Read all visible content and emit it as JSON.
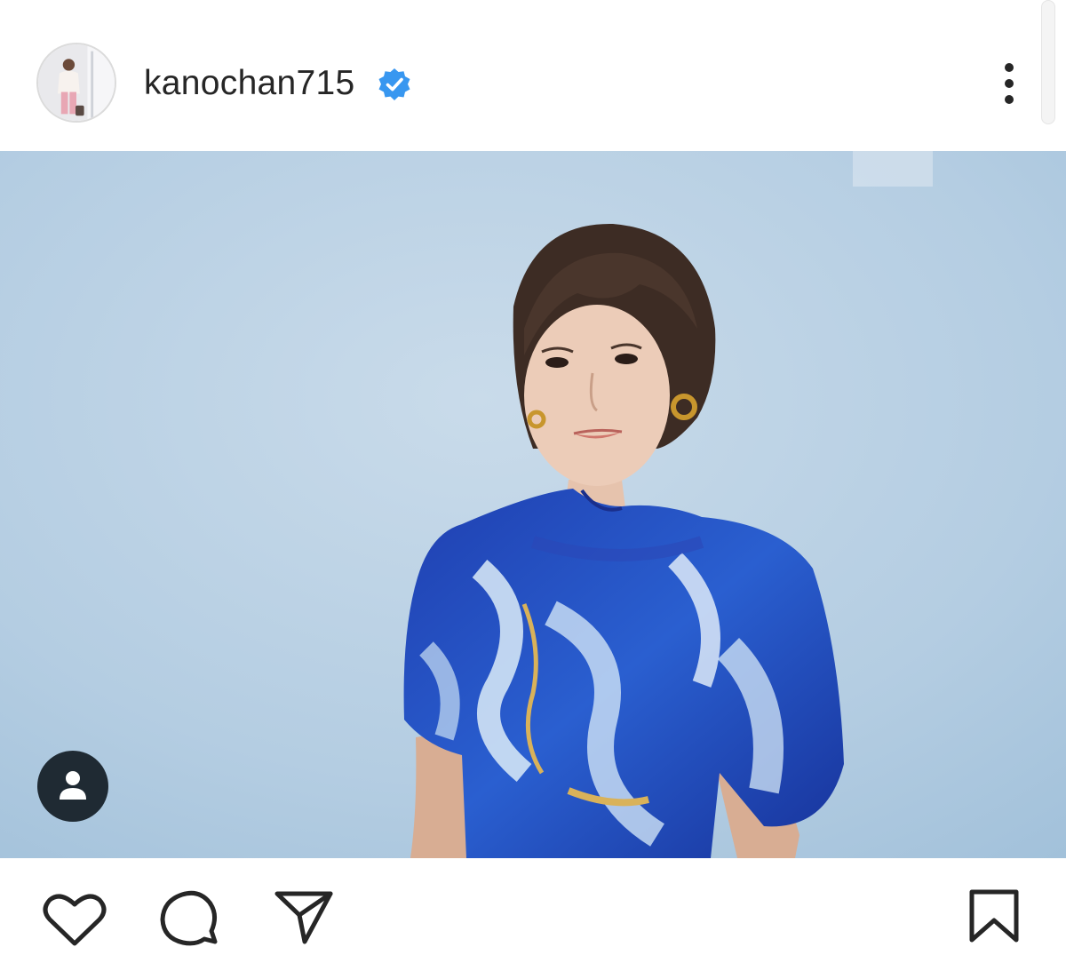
{
  "post": {
    "username": "kanochan715",
    "verified": true,
    "profile_icon": "avatar",
    "menu_icon": "more-vertical-icon"
  },
  "photo": {
    "tag_icon": "user-tag-icon"
  },
  "actions": {
    "like_icon": "heart-icon",
    "comment_icon": "comment-icon",
    "share_icon": "send-icon",
    "save_icon": "bookmark-icon"
  },
  "colors": {
    "verified_badge": "#3897f0",
    "text": "#262626",
    "photo_background": "#b9d2e6",
    "tag_button": "#1f2a33"
  }
}
